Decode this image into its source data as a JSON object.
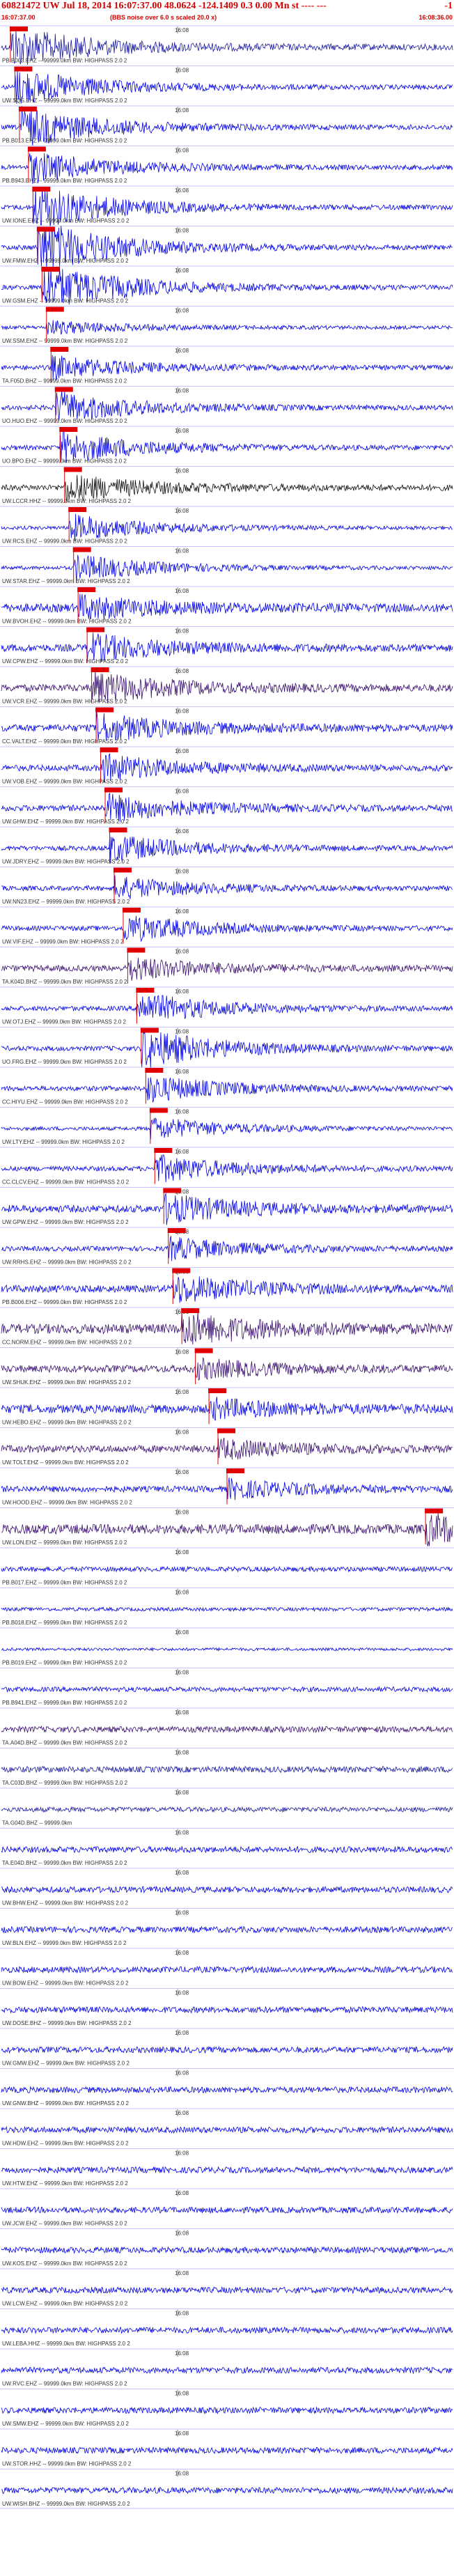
{
  "header": {
    "title": "60821472 UW Jul 18, 2014 16:07:37.00   48.0624 -124.1409  0.3 0.00 Mn st  ---- ---",
    "title_end": "-1",
    "start_time": "16:07:37.00",
    "note": "(BBS noise over 6.0 s scaled 20.0 x)",
    "end_time": "16:08:36.00"
  },
  "colors": {
    "trace_blue": "#0000e6",
    "trace_navy": "#1a1aa0",
    "trace_purple": "#3a1070",
    "trace_black": "#101010",
    "pick_red": "#e00000",
    "label_gray": "#333333"
  },
  "chart_data": {
    "type": "line",
    "title": "60821472 UW Jul 18, 2014 16:07:37.00",
    "x_range": [
      "16:07:37.00",
      "16:08:36.00"
    ],
    "minute_mark": "16:08",
    "filter": "HIGHPASS 2.0 2",
    "series": [
      {
        "name": "PB.B003.EHZ",
        "label": "PB.B003.EHZ -- 99999.0km BW: HIGHPASS  2.0  2",
        "pick": 0.02,
        "amp": 0.25,
        "event": 0.9,
        "color": "trace_navy"
      },
      {
        "name": "UW.SQS.EHZ",
        "label": "UW.SQS.EHZ -- 99999.0km BW: HIGHPASS  2.0  2",
        "pick": 0.03,
        "amp": 0.2,
        "event": 0.8,
        "color": "trace_blue"
      },
      {
        "name": "PB.B013.EHZ",
        "label": "PB.B013.EHZ -- 99999.0km BW: HIGHPASS  2.0  2",
        "pick": 0.04,
        "amp": 0.2,
        "event": 0.9,
        "color": "trace_blue"
      },
      {
        "name": "PB.B943.EHZ",
        "label": "PB.B943.EHZ -- 99999.0km BW: HIGHPASS  2.0  2",
        "pick": 0.06,
        "amp": 0.2,
        "event": 0.7,
        "color": "trace_blue"
      },
      {
        "name": "UW.IONE.EHZ",
        "label": "UW.IONE.EHZ -- 99999.0km BW: HIGHPASS  2.0  2",
        "pick": 0.07,
        "amp": 0.2,
        "event": 1.0,
        "color": "trace_blue"
      },
      {
        "name": "UW.FMW.EHZ",
        "label": "UW.FMW.EHZ -- 99999.0km BW: HIGHPASS  2.0  2",
        "pick": 0.08,
        "amp": 0.2,
        "event": 1.2,
        "color": "trace_blue"
      },
      {
        "name": "UW.GSM.EHZ",
        "label": "UW.GSM.EHZ -- 99999.0km BW: HIGHPASS  2.0  2",
        "pick": 0.09,
        "amp": 0.2,
        "event": 1.1,
        "color": "trace_blue"
      },
      {
        "name": "UW.SSM.EHZ",
        "label": "UW.SSM.EHZ -- 99999.0km BW: HIGHPASS  2.0  2",
        "pick": 0.1,
        "amp": 0.15,
        "event": 0.3,
        "color": "trace_blue"
      },
      {
        "name": "TA.F05D.BHZ",
        "label": "TA.F05D.BHZ -- 99999.0km BW: HIGHPASS  2.0  2",
        "pick": 0.11,
        "amp": 0.2,
        "event": 0.5,
        "color": "trace_blue"
      },
      {
        "name": "UO.HUO.EHZ",
        "label": "UO.HUO.EHZ -- 99999.0km BW: HIGHPASS  2.0  2",
        "pick": 0.12,
        "amp": 0.2,
        "event": 0.7,
        "color": "trace_blue"
      },
      {
        "name": "UO.BPO.EHZ",
        "label": "UO.BPO.EHZ -- 99999.0km BW: HIGHPASS  2.0  2",
        "pick": 0.13,
        "amp": 0.2,
        "event": 0.7,
        "color": "trace_blue"
      },
      {
        "name": "UW.LCCR.HHZ",
        "label": "UW.LCCR.HHZ -- 99999.0km BW: HIGHPASS  2.0  2",
        "pick": 0.14,
        "amp": 0.25,
        "event": 0.6,
        "color": "trace_black"
      },
      {
        "name": "UW.RCS.EHZ",
        "label": "UW.RCS.EHZ -- 99999.0km BW: HIGHPASS  2.0  2",
        "pick": 0.15,
        "amp": 0.15,
        "event": 0.6,
        "color": "trace_blue"
      },
      {
        "name": "UW.STAR.EHZ",
        "label": "UW.STAR.EHZ -- 99999.0km BW: HIGHPASS  2.0  2",
        "pick": 0.16,
        "amp": 0.15,
        "event": 0.6,
        "color": "trace_blue"
      },
      {
        "name": "UW.BVOH.EHZ",
        "label": "UW.BVOH.EHZ -- 99999.0km BW: HIGHPASS  2.0  2",
        "pick": 0.17,
        "amp": 0.35,
        "event": 0.5,
        "color": "trace_blue"
      },
      {
        "name": "UW.CPW.EHZ",
        "label": "UW.CPW.EHZ -- 99999.0km BW: HIGHPASS  2.0  2",
        "pick": 0.19,
        "amp": 0.3,
        "event": 0.6,
        "color": "trace_blue"
      },
      {
        "name": "UW.VCR.EHZ",
        "label": "UW.VCR.EHZ -- 99999.0km BW: HIGHPASS  2.0  2",
        "pick": 0.2,
        "amp": 0.3,
        "event": 0.7,
        "color": "trace_purple"
      },
      {
        "name": "CC.VALT.EHZ",
        "label": "CC.VALT.EHZ -- 99999.0km BW: HIGHPASS  2.0  2",
        "pick": 0.21,
        "amp": 0.3,
        "event": 0.6,
        "color": "trace_blue"
      },
      {
        "name": "UW.VOB.EHZ",
        "label": "UW.VOB.EHZ -- 99999.0km BW: HIGHPASS  2.0  2",
        "pick": 0.22,
        "amp": 0.25,
        "event": 0.6,
        "color": "trace_blue"
      },
      {
        "name": "UW.GHW.EHZ",
        "label": "UW.GHW.EHZ -- 99999.0km BW: HIGHPASS  2.0  2",
        "pick": 0.23,
        "amp": 0.25,
        "event": 0.6,
        "color": "trace_blue"
      },
      {
        "name": "UW.JDRY.EHZ",
        "label": "UW.JDRY.EHZ -- 99999.0km BW: HIGHPASS  2.0  2",
        "pick": 0.24,
        "amp": 0.2,
        "event": 0.6,
        "color": "trace_blue"
      },
      {
        "name": "UW.NN23.EHZ",
        "label": "UW.NN23.EHZ -- 99999.0km BW: HIGHPASS  2.0  2",
        "pick": 0.25,
        "amp": 0.2,
        "event": 0.5,
        "color": "trace_blue"
      },
      {
        "name": "UW.VIF.EHZ",
        "label": "UW.VIF.EHZ -- 99999.0km BW: HIGHPASS  2.0  2",
        "pick": 0.27,
        "amp": 0.2,
        "event": 0.6,
        "color": "trace_blue"
      },
      {
        "name": "TA.K04D.BHZ",
        "label": "TA.K04D.BHZ -- 99999.0km BW: HIGHPASS  2.0  2",
        "pick": 0.28,
        "amp": 0.25,
        "event": 0.5,
        "color": "trace_purple"
      },
      {
        "name": "UW.OTJ.EHZ",
        "label": "UW.OTJ.EHZ -- 99999.0km BW: HIGHPASS  2.0  2",
        "pick": 0.3,
        "amp": 0.2,
        "event": 0.7,
        "color": "trace_blue"
      },
      {
        "name": "UO.FRG.EHZ",
        "label": "UO.FRG.EHZ -- 99999.0km BW: HIGHPASS  2.0  2",
        "pick": 0.31,
        "amp": 0.2,
        "event": 0.9,
        "color": "trace_blue"
      },
      {
        "name": "CC.HIYU.EHZ",
        "label": "CC.HIYU.EHZ -- 99999.0km BW: HIGHPASS  2.0  2",
        "pick": 0.32,
        "amp": 0.2,
        "event": 0.6,
        "color": "trace_blue"
      },
      {
        "name": "UW.LTY.EHZ",
        "label": "UW.LTY.EHZ -- 99999.0km BW: HIGHPASS  2.0  2",
        "pick": 0.33,
        "amp": 0.15,
        "event": 0.5,
        "color": "trace_blue"
      },
      {
        "name": "CC.CLCV.EHZ",
        "label": "CC.CLCV.EHZ -- 99999.0km BW: HIGHPASS  2.0  2",
        "pick": 0.34,
        "amp": 0.2,
        "event": 0.6,
        "color": "trace_blue"
      },
      {
        "name": "UW.GPW.EHZ",
        "label": "UW.GPW.EHZ -- 99999.0km BW: HIGHPASS  2.0  2",
        "pick": 0.36,
        "amp": 0.3,
        "event": 0.6,
        "color": "trace_blue"
      },
      {
        "name": "UW.RRHS.EHZ",
        "label": "UW.RRHS.EHZ -- 99999.0km BW: HIGHPASS  2.0  2",
        "pick": 0.37,
        "amp": 0.2,
        "event": 0.5,
        "color": "trace_blue"
      },
      {
        "name": "PB.B006.EHZ",
        "label": "PB.B006.EHZ -- 99999.0km BW: HIGHPASS  2.0  2",
        "pick": 0.38,
        "amp": 0.3,
        "event": 0.6,
        "color": "trace_blue"
      },
      {
        "name": "CC.NORM.EHZ",
        "label": "CC.NORM.EHZ -- 99999.0km BW: HIGHPASS  2.0  2",
        "pick": 0.4,
        "amp": 0.4,
        "event": 0.7,
        "color": "trace_purple"
      },
      {
        "name": "UW.SHUK.EHZ",
        "label": "UW.SHUK.EHZ -- 99999.0km BW: HIGHPASS  2.0  2",
        "pick": 0.43,
        "amp": 0.3,
        "event": 0.4,
        "color": "trace_purple"
      },
      {
        "name": "UW.HEBO.EHZ",
        "label": "UW.HEBO.EHZ -- 99999.0km BW: HIGHPASS  2.0  2",
        "pick": 0.46,
        "amp": 0.35,
        "event": 0.4,
        "color": "trace_blue"
      },
      {
        "name": "UW.TOLT.EHZ",
        "label": "UW.TOLT.EHZ -- 99999.0km BW: HIGHPASS  2.0  2",
        "pick": 0.48,
        "amp": 0.3,
        "event": 0.4,
        "color": "trace_purple"
      },
      {
        "name": "UW.HOOD.EHZ",
        "label": "UW.HOOD.EHZ -- 99999.0km BW: HIGHPASS  2.0  2",
        "pick": 0.5,
        "amp": 0.25,
        "event": 0.4,
        "color": "trace_blue"
      },
      {
        "name": "UW.LON.EHZ",
        "label": "UW.LON.EHZ -- 99999.0km BW: HIGHPASS  2.0  2",
        "pick": 0.94,
        "amp": 0.4,
        "event": 0.6,
        "color": "trace_purple"
      },
      {
        "name": "PB.B017.EHZ",
        "label": "PB.B017.EHZ -- 99999.0km BW: HIGHPASS  2.0  2",
        "pick": null,
        "amp": 0.2,
        "event": 0,
        "color": "trace_blue"
      },
      {
        "name": "PB.B018.EHZ",
        "label": "PB.B018.EHZ -- 99999.0km BW: HIGHPASS  2.0  2",
        "pick": null,
        "amp": 0.15,
        "event": 0,
        "color": "trace_blue"
      },
      {
        "name": "PB.B019.EHZ",
        "label": "PB.B019.EHZ -- 99999.0km BW: HIGHPASS  2.0  2",
        "pick": null,
        "amp": 0.12,
        "event": 0,
        "color": "trace_blue"
      },
      {
        "name": "PB.B941.EHZ",
        "label": "PB.B941.EHZ -- 99999.0km BW: HIGHPASS  2.0  2",
        "pick": null,
        "amp": 0.2,
        "event": 0,
        "color": "trace_blue"
      },
      {
        "name": "TA.A04D.BHZ",
        "label": "TA.A04D.BHZ -- 99999.0km BW: HIGHPASS  2.0  2",
        "pick": null,
        "amp": 0.25,
        "event": 0,
        "color": "trace_purple"
      },
      {
        "name": "TA.C03D.BHZ",
        "label": "TA.C03D.BHZ -- 99999.0km BW: HIGHPASS  2.0  2",
        "pick": null,
        "amp": 0.25,
        "event": 0,
        "color": "trace_navy"
      },
      {
        "name": "TA.G04D.BHZ",
        "label": "TA.G04D.BHZ -- 99999.0km",
        "pick": null,
        "amp": 0.2,
        "event": 0,
        "color": "trace_navy"
      },
      {
        "name": "TA.E04D.BHZ",
        "label": "TA.E04D.BHZ -- 99999.0km BW: HIGHPASS  2.0  2",
        "pick": null,
        "amp": 0.25,
        "event": 0,
        "color": "trace_blue"
      },
      {
        "name": "UW.BHW.EHZ",
        "label": "UW.BHW.EHZ -- 99999.0km BW: HIGHPASS  2.0  2",
        "pick": null,
        "amp": 0.25,
        "event": 0,
        "color": "trace_blue"
      },
      {
        "name": "UW.BLN.EHZ",
        "label": "UW.BLN.EHZ -- 99999.0km BW: HIGHPASS  2.0  2",
        "pick": null,
        "amp": 0.25,
        "event": 0,
        "color": "trace_blue"
      },
      {
        "name": "UW.BOW.EHZ",
        "label": "UW.BOW.EHZ -- 99999.0km BW: HIGHPASS  2.0  2",
        "pick": null,
        "amp": 0.25,
        "event": 0,
        "color": "trace_blue"
      },
      {
        "name": "UW.DOSE.BHZ",
        "label": "UW.DOSE.BHZ -- 99999.0km BW: HIGHPASS  2.0  2",
        "pick": null,
        "amp": 0.25,
        "event": 0,
        "color": "trace_blue"
      },
      {
        "name": "UW.GMW.EHZ",
        "label": "UW.GMW.EHZ -- 99999.0km BW: HIGHPASS  2.0  2",
        "pick": null,
        "amp": 0.25,
        "event": 0,
        "color": "trace_blue"
      },
      {
        "name": "UW.GNW.BHZ",
        "label": "UW.GNW.BHZ -- 99999.0km BW: HIGHPASS  2.0  2",
        "pick": null,
        "amp": 0.25,
        "event": 0,
        "color": "trace_blue"
      },
      {
        "name": "UW.HDW.EHZ",
        "label": "UW.HDW.EHZ -- 99999.0km BW: HIGHPASS  2.0  2",
        "pick": null,
        "amp": 0.25,
        "event": 0,
        "color": "trace_blue"
      },
      {
        "name": "UW.HTW.EHZ",
        "label": "UW.HTW.EHZ -- 99999.0km BW: HIGHPASS  2.0  2",
        "pick": null,
        "amp": 0.25,
        "event": 0,
        "color": "trace_blue"
      },
      {
        "name": "UW.JCW.EHZ",
        "label": "UW.JCW.EHZ -- 99999.0km BW: HIGHPASS  2.0  2",
        "pick": null,
        "amp": 0.25,
        "event": 0,
        "color": "trace_blue"
      },
      {
        "name": "UW.KOS.EHZ",
        "label": "UW.KOS.EHZ -- 99999.0km BW: HIGHPASS  2.0  2",
        "pick": null,
        "amp": 0.25,
        "event": 0,
        "color": "trace_blue"
      },
      {
        "name": "UW.LCW.EHZ",
        "label": "UW.LCW.EHZ -- 99999.0km BW: HIGHPASS  2.0  2",
        "pick": null,
        "amp": 0.25,
        "event": 0,
        "color": "trace_blue"
      },
      {
        "name": "UW.LEBA.HHZ",
        "label": "UW.LEBA.HHZ -- 99999.0km BW: HIGHPASS  2.0  2",
        "pick": null,
        "amp": 0.25,
        "event": 0,
        "color": "trace_blue"
      },
      {
        "name": "UW.RVC.EHZ",
        "label": "UW.RVC.EHZ -- 99999.0km BW: HIGHPASS  2.0  2",
        "pick": null,
        "amp": 0.25,
        "event": 0,
        "color": "trace_blue"
      },
      {
        "name": "UW.SMW.EHZ",
        "label": "UW.SMW.EHZ -- 99999.0km BW: HIGHPASS  2.0  2",
        "pick": null,
        "amp": 0.25,
        "event": 0,
        "color": "trace_blue"
      },
      {
        "name": "UW.STOR.HHZ",
        "label": "UW.STOR.HHZ -- 99999.0km BW: HIGHPASS  2.0  2",
        "pick": null,
        "amp": 0.25,
        "event": 0,
        "color": "trace_blue"
      },
      {
        "name": "UW.WISH.BHZ",
        "label": "UW.WISH.BHZ -- 99999.0km BW: HIGHPASS  2.0  2",
        "pick": null,
        "amp": 0.25,
        "event": 0,
        "color": "trace_blue"
      }
    ]
  }
}
